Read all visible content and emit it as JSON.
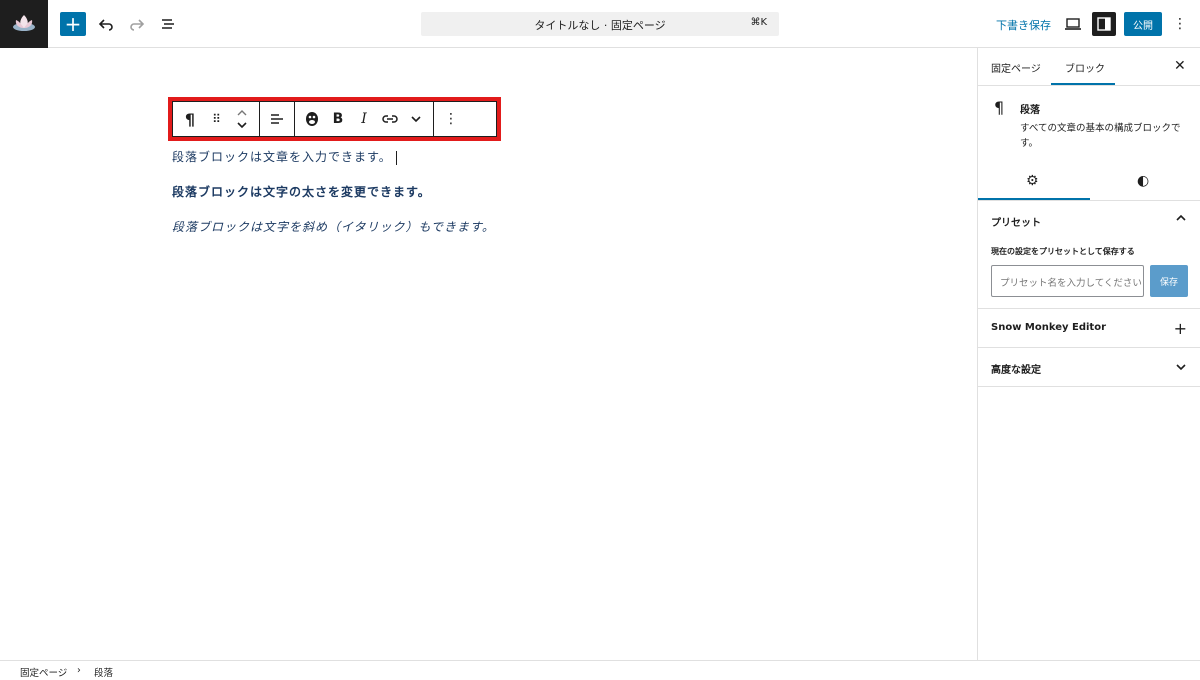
{
  "topbar": {
    "add_icon": "plus-icon",
    "command_title": "タイトルなし · 固定ページ",
    "command_shortcut": "⌘K",
    "draft_label": "下書き保存",
    "publish_label": "公開"
  },
  "block_toolbar": {
    "buttons": [
      "paragraph",
      "drag",
      "move",
      "align",
      "snow-monkey",
      "bold",
      "italic",
      "link",
      "more-formats",
      "options"
    ]
  },
  "content": {
    "paragraphs": [
      "段落ブロックは文章を入力できます。",
      "段落ブロックは文字の太さを変更できます。",
      "段落ブロックは文字を斜め（イタリック）もできます。"
    ]
  },
  "sidebar": {
    "tabs": [
      "固定ページ",
      "ブロック"
    ],
    "active_tab": "ブロック",
    "block_title": "段落",
    "block_desc": "すべての文章の基本の構成ブロックです。",
    "preset_panel": "プリセット",
    "preset_label": "現在の設定をプリセットとして保存する",
    "preset_placeholder": "プリセット名を入力してください",
    "preset_save": "保存",
    "snow_monkey_panel": "Snow Monkey Editor",
    "advanced_panel": "高度な設定"
  },
  "breadcrumb": {
    "items": [
      "固定ページ",
      "段落"
    ],
    "separator": "›"
  },
  "colors": {
    "accent": "#0073aa",
    "highlight": "#e21b1b",
    "text_blue": "#1c3a62"
  }
}
